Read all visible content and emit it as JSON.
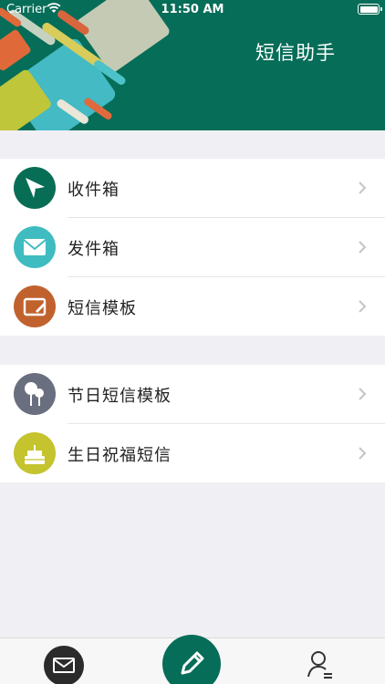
{
  "status_bar": {
    "carrier": "Carrier",
    "time": "11:50 AM"
  },
  "header": {
    "title": "短信助手"
  },
  "colors": {
    "primary": "#066d58",
    "inbox_icon": "#086d55",
    "outbox_icon": "#3fbcc0",
    "template_icon": "#c1622e",
    "holiday_icon": "#6a6f80",
    "birthday_icon": "#c5c32e"
  },
  "menu_group_1": [
    {
      "label": "收件箱",
      "icon": "paper-plane-icon"
    },
    {
      "label": "发件箱",
      "icon": "envelope-icon"
    },
    {
      "label": "短信模板",
      "icon": "edit-template-icon"
    }
  ],
  "menu_group_2": [
    {
      "label": "节日短信模板",
      "icon": "lollipop-icon"
    },
    {
      "label": "生日祝福短信",
      "icon": "cake-icon"
    }
  ],
  "tab_bar": {
    "items": [
      "mail-icon",
      "pencil-icon",
      "user-icon"
    ]
  }
}
